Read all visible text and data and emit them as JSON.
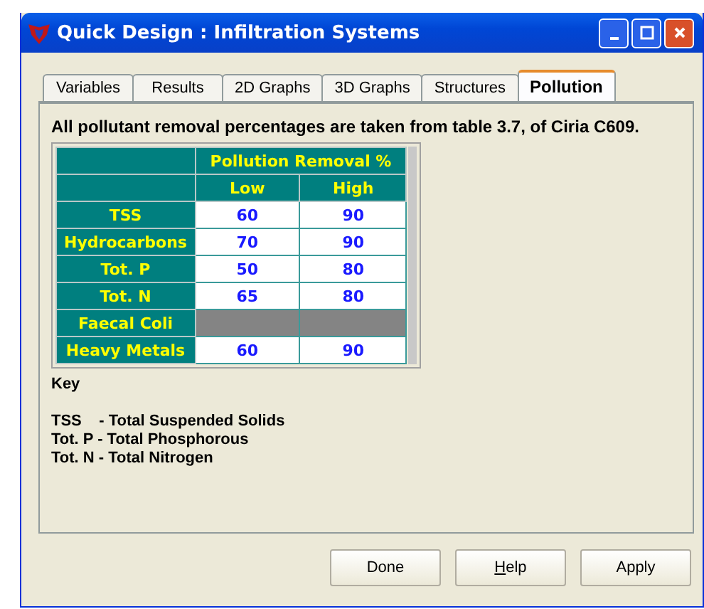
{
  "window": {
    "title": "Quick Design : Infiltration Systems"
  },
  "tabs": [
    {
      "label": "Variables",
      "selected": false
    },
    {
      "label": "Results",
      "selected": false
    },
    {
      "label": "2D Graphs",
      "selected": false
    },
    {
      "label": "3D Graphs",
      "selected": false
    },
    {
      "label": "Structures",
      "selected": false
    },
    {
      "label": "Pollution",
      "selected": true
    }
  ],
  "note": "All pollutant removal percentages are taken from table 3.7, of Ciria C609.",
  "table": {
    "group_heading": "Pollution Removal %",
    "columns": [
      "Low",
      "High"
    ],
    "rows": [
      {
        "label": "TSS",
        "low": "60",
        "high": "90",
        "disabled": false
      },
      {
        "label": "Hydrocarbons",
        "low": "70",
        "high": "90",
        "disabled": false
      },
      {
        "label": "Tot. P",
        "low": "50",
        "high": "80",
        "disabled": false
      },
      {
        "label": "Tot. N",
        "low": "65",
        "high": "80",
        "disabled": false
      },
      {
        "label": "Faecal Coli",
        "disabled": true
      },
      {
        "label": "Heavy Metals",
        "low": "60",
        "high": "90",
        "disabled": false
      }
    ]
  },
  "key": {
    "heading": "Key",
    "lines": [
      "TSS    - Total Suspended Solids",
      "Tot. P - Total Phosphorous",
      "Tot. N - Total Nitrogen"
    ]
  },
  "buttons": [
    {
      "label": "Done",
      "underline_first": false
    },
    {
      "label": "Help",
      "underline_first": true
    },
    {
      "label": "Apply",
      "underline_first": false
    }
  ]
}
